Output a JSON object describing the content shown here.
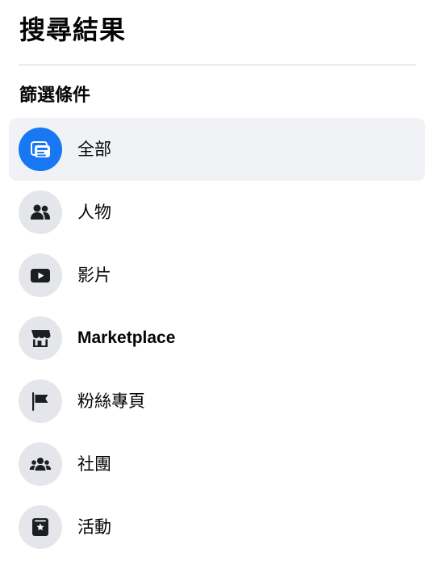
{
  "header": {
    "title": "搜尋結果"
  },
  "filters": {
    "section_title": "篩選條件",
    "selected_index": 0,
    "accent_color": "#1877f2",
    "items": [
      {
        "label": "全部",
        "icon": "all-results-icon"
      },
      {
        "label": "人物",
        "icon": "people-icon"
      },
      {
        "label": "影片",
        "icon": "video-play-icon"
      },
      {
        "label": "Marketplace",
        "icon": "marketplace-shop-icon"
      },
      {
        "label": "粉絲專頁",
        "icon": "page-flag-icon"
      },
      {
        "label": "社團",
        "icon": "groups-icon"
      },
      {
        "label": "活動",
        "icon": "event-star-icon"
      }
    ]
  }
}
